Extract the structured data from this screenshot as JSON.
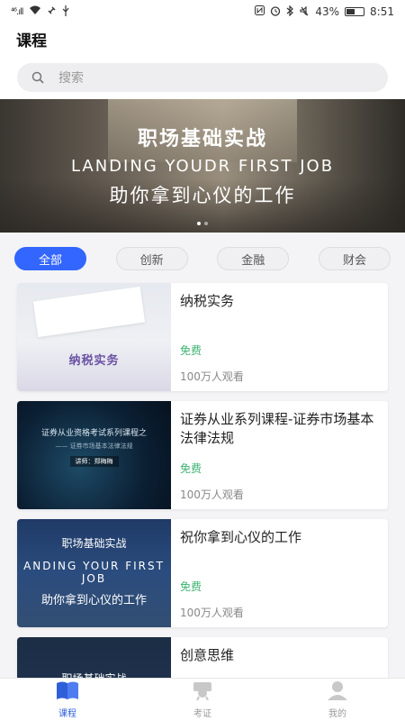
{
  "status_bar": {
    "signal": "⁴⁶.ıll",
    "battery": "43%",
    "time": "8:51"
  },
  "header": {
    "title": "课程"
  },
  "search": {
    "placeholder": "搜索"
  },
  "banner": {
    "title": "职场基础实战",
    "subtitle": "LANDING YOUDR FIRST JOB",
    "tagline": "助你拿到心仪的工作",
    "dots": 2,
    "active_dot": 0
  },
  "tabs": [
    {
      "label": "全部",
      "active": true
    },
    {
      "label": "创新",
      "active": false
    },
    {
      "label": "金融",
      "active": false
    },
    {
      "label": "财会",
      "active": false
    }
  ],
  "courses": [
    {
      "title": "纳税实务",
      "price": "免费",
      "views": "100万人观看",
      "thumb_text": [
        "纳税实务"
      ]
    },
    {
      "title": "证券从业系列课程-证券市场基本法律法规",
      "price": "免费",
      "views": "100万人观看",
      "thumb_text": [
        "证券从业资格考试系列课程之",
        "—— 证券市场基本法律法规",
        "讲师：郑梅梅"
      ]
    },
    {
      "title": "祝你拿到心仪的工作",
      "price": "免费",
      "views": "100万人观看",
      "thumb_text": [
        "职场基础实战",
        "ANDING YOUR FIRST JOB",
        "助你拿到心仪的工作"
      ]
    },
    {
      "title": "创意思维",
      "price": "",
      "views": "",
      "thumb_text": [
        "职场基础实战"
      ]
    }
  ],
  "bottom_nav": [
    {
      "label": "课程",
      "icon": "book-icon",
      "active": true
    },
    {
      "label": "考证",
      "icon": "certificate-icon",
      "active": false
    },
    {
      "label": "我的",
      "icon": "user-icon",
      "active": false
    }
  ],
  "colors": {
    "accent": "#3366ff",
    "price": "#3cb371",
    "nav_active": "#2f5fd8"
  }
}
